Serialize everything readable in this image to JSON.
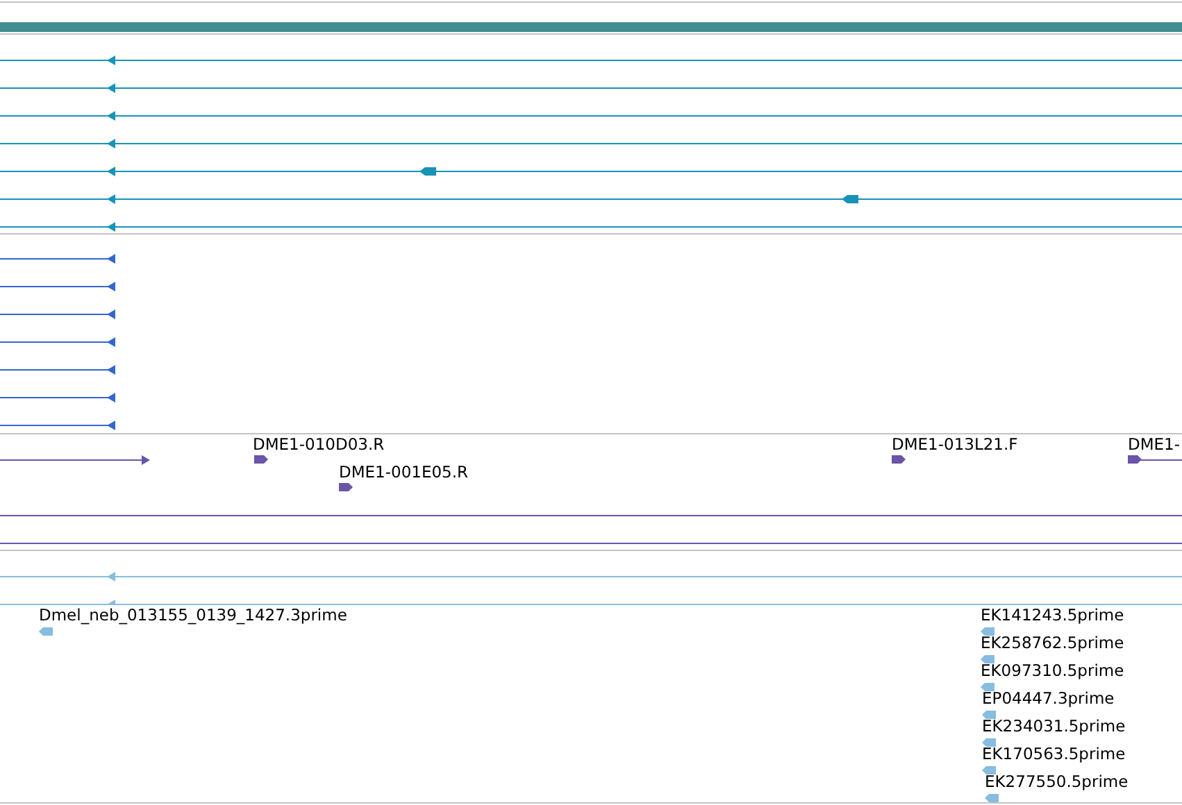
{
  "tracks": [
    {
      "kind": "summary",
      "color": "#3f8f92"
    },
    {
      "kind": "lines",
      "color": "#1793b7",
      "rows": [
        {
          "reverse": true
        },
        {
          "reverse": true
        },
        {
          "reverse": true
        },
        {
          "reverse": true
        },
        {
          "reverse": true
        },
        {
          "reverse": true
        },
        {
          "reverse": true
        }
      ]
    },
    {
      "kind": "stubs",
      "color": "#3367cc",
      "rows": [
        {
          "reverse": true
        },
        {
          "reverse": true
        },
        {
          "reverse": true
        },
        {
          "reverse": true
        },
        {
          "reverse": true
        },
        {
          "reverse": true
        },
        {
          "reverse": true
        }
      ]
    },
    {
      "kind": "labeled",
      "color": "#6a55a8",
      "rows": [
        {
          "reverse": false
        }
      ],
      "features": [
        {
          "label": "DME1-010D03.R",
          "reverse": false
        },
        {
          "label": "DME1-001E05.R",
          "reverse": false
        },
        {
          "label": "DME1-013L21.F",
          "reverse": false
        },
        {
          "label": "DME1-",
          "reverse": false
        }
      ]
    },
    {
      "kind": "lines",
      "color": "#86bde0",
      "rows": [
        {
          "reverse": true
        },
        {
          "reverse": true
        }
      ]
    },
    {
      "kind": "labeled",
      "color": "#86bde0",
      "features": [
        {
          "label": "Dmel_neb_013155_0139_1427.3prime",
          "reverse": true
        },
        {
          "label": "EK141243.5prime",
          "reverse": true
        },
        {
          "label": "EK258762.5prime",
          "reverse": true
        },
        {
          "label": "EK097310.5prime",
          "reverse": true
        },
        {
          "label": "EP04447.3prime",
          "reverse": true
        },
        {
          "label": "EK234031.5prime",
          "reverse": true
        },
        {
          "label": "EK170563.5prime",
          "reverse": true
        },
        {
          "label": "EK277550.5prime",
          "reverse": true
        }
      ]
    }
  ]
}
